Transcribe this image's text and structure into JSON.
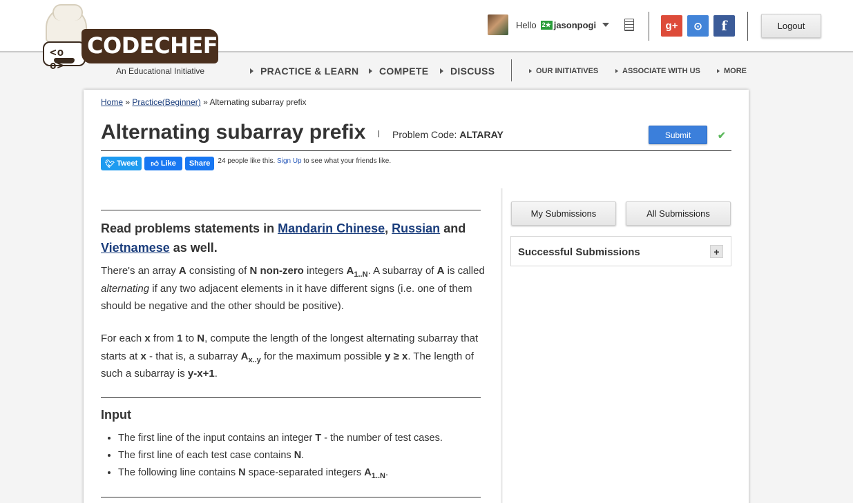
{
  "header": {
    "logo_text": "CODECHEF",
    "tagline": "An Educational Initiative",
    "hello_label": "Hello",
    "user_badge": "2★",
    "username": "jasonpogi",
    "social": {
      "gplus": "g+",
      "github": "⊙",
      "facebook": "f"
    },
    "logout_label": "Logout"
  },
  "nav": {
    "main": [
      "PRACTICE & LEARN",
      "COMPETE",
      "DISCUSS"
    ],
    "secondary": [
      "OUR INITIATIVES",
      "ASSOCIATE WITH US",
      "MORE"
    ]
  },
  "breadcrumb": {
    "home": "Home",
    "sep1": "»",
    "practice": "Practice(Beginner)",
    "sep2": "»",
    "current": "Alternating subarray prefix"
  },
  "problem": {
    "title": "Alternating subarray prefix",
    "code_label": "Problem Code:",
    "code": "ALTARAY",
    "submit_label": "Submit",
    "solved_mark": "✔"
  },
  "share": {
    "tweet": "Tweet",
    "like": "Like",
    "share": "Share",
    "likes_text": "24 people like this.",
    "signup": "Sign Up",
    "likes_suffix": "to see what your friends like."
  },
  "statement": {
    "heading_prefix": "Read problems statements in",
    "lang1": "Mandarin Chinese",
    "comma": ",",
    "lang2": "Russian",
    "and": "and",
    "lang3": "Vietnamese",
    "heading_suffix": "as well."
  },
  "input_section": {
    "title": "Input"
  },
  "sidebar": {
    "my_submissions": "My Submissions",
    "all_submissions": "All Submissions",
    "successful_submissions": "Successful Submissions",
    "expand_label": "+"
  }
}
